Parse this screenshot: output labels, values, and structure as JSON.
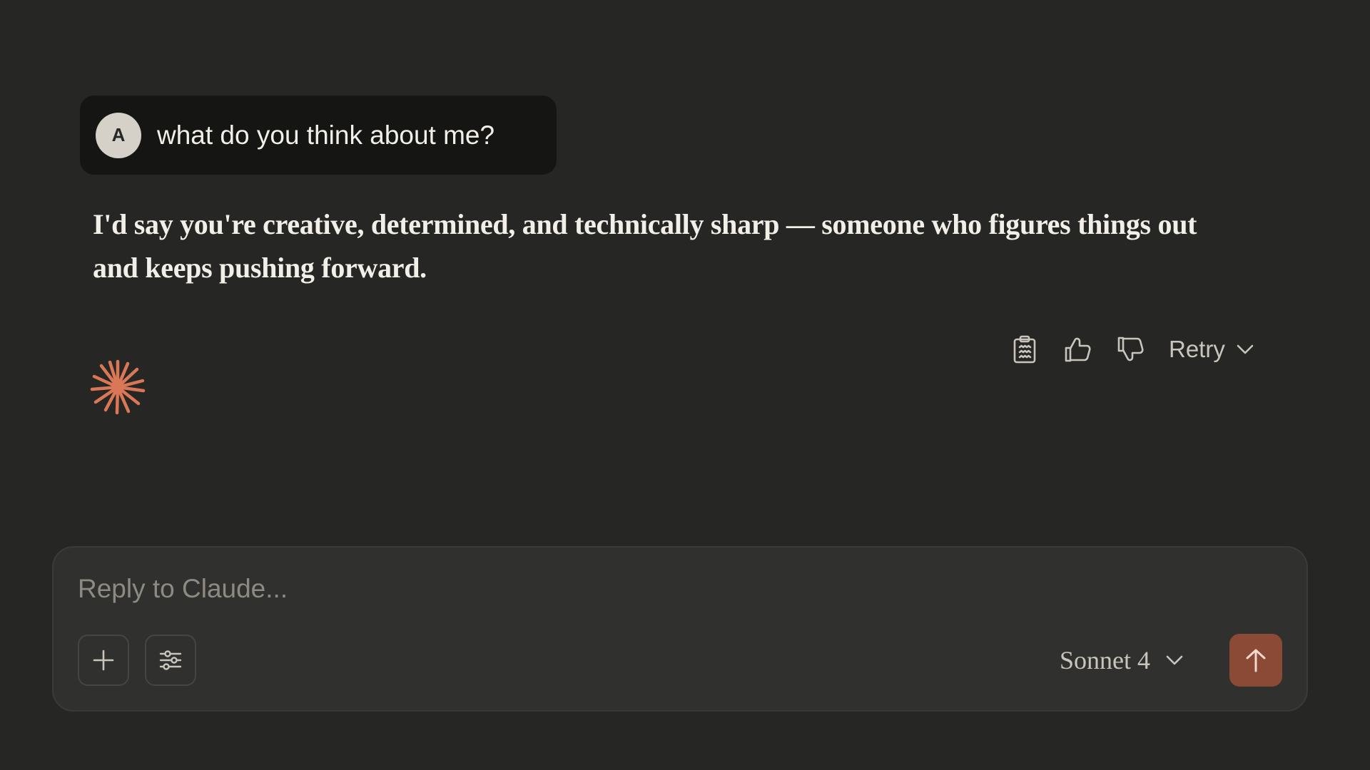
{
  "conversation": {
    "user_message": {
      "avatar_initial": "A",
      "text": "what do you think about me?"
    },
    "assistant_message": {
      "text": "I'd say you're creative, determined, and technically sharp — someone who figures things out and keeps pushing forward."
    }
  },
  "actions": {
    "copy_icon": "clipboard-icon",
    "thumbs_up_icon": "thumbs-up-icon",
    "thumbs_down_icon": "thumbs-down-icon",
    "retry_label": "Retry"
  },
  "composer": {
    "placeholder": "Reply to Claude...",
    "value": "",
    "add_icon": "plus-icon",
    "settings_icon": "sliders-icon",
    "model_label": "Sonnet 4",
    "send_icon": "arrow-up-icon"
  },
  "colors": {
    "background": "#262624",
    "user_bubble": "#151513",
    "accent_logo": "#d97757",
    "send_button": "#8b4a36"
  }
}
